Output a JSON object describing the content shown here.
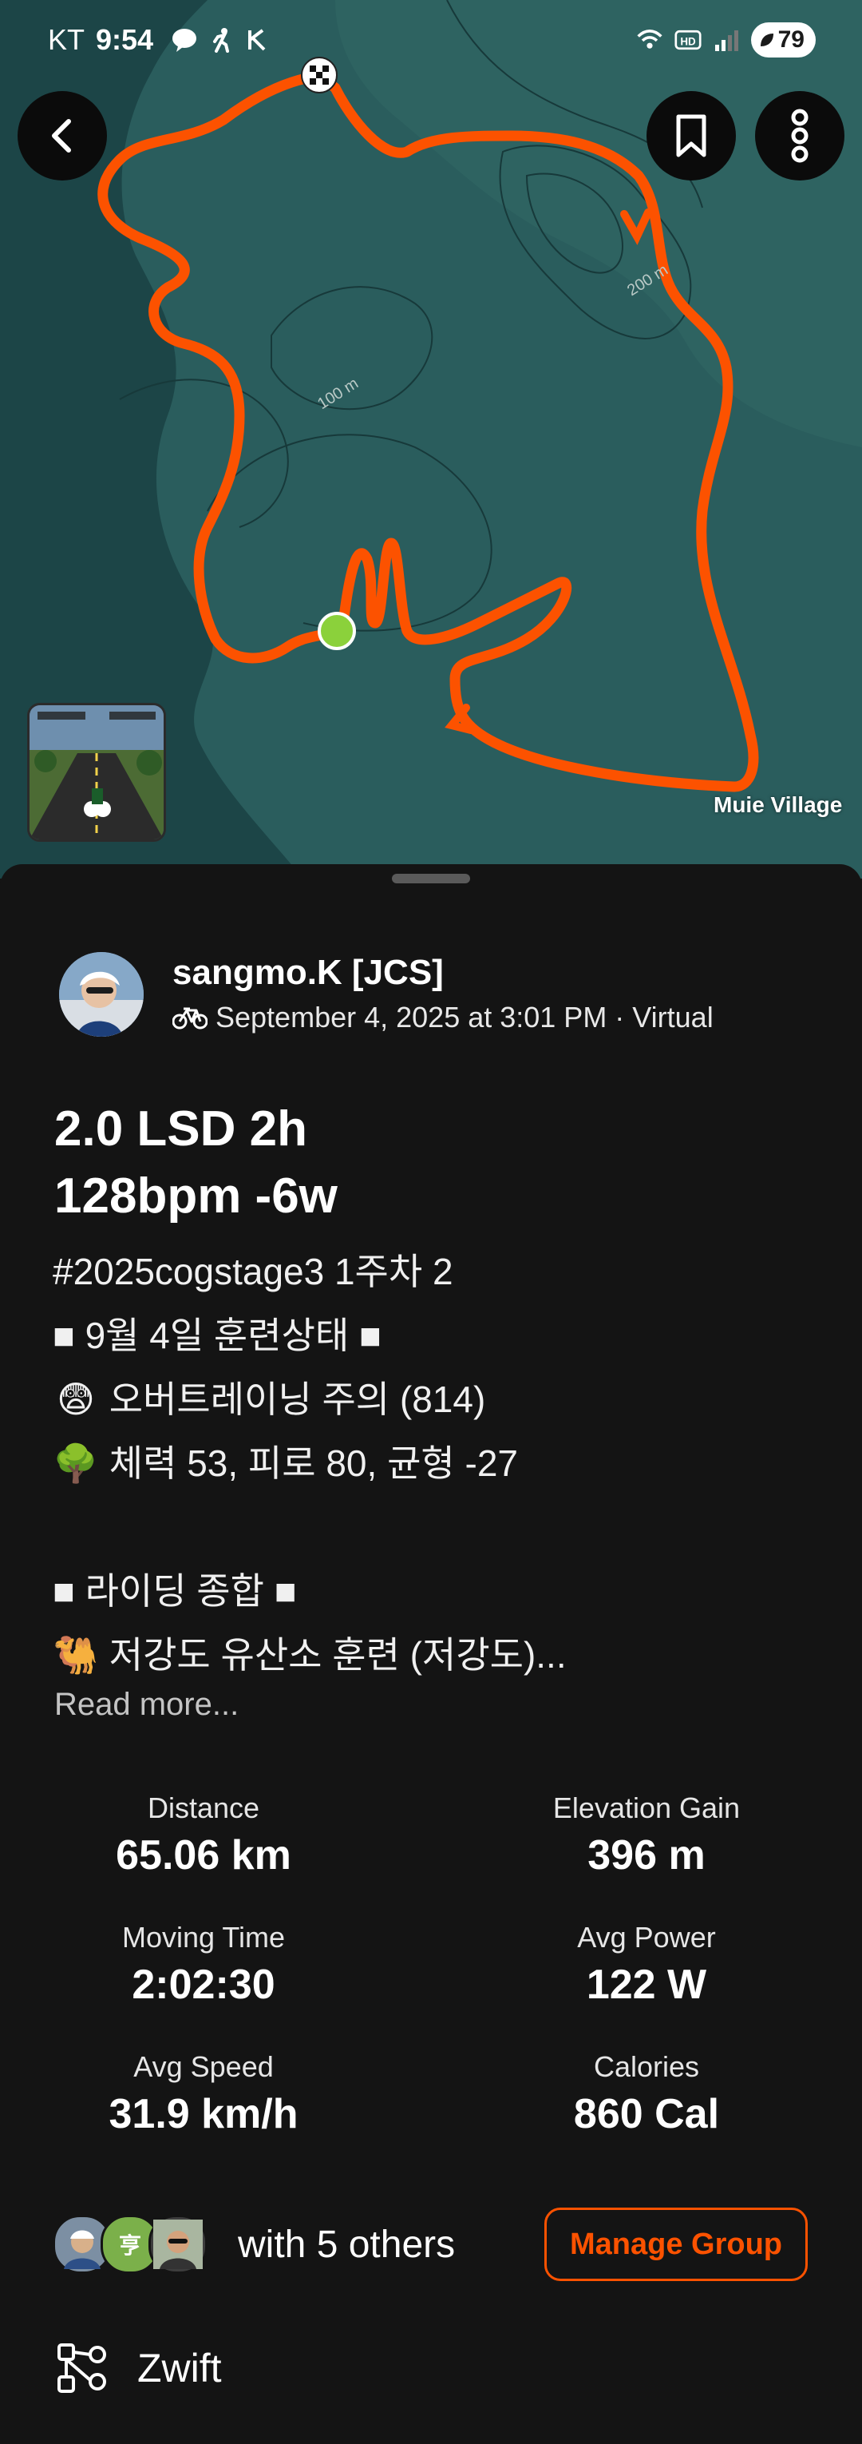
{
  "status_bar": {
    "carrier": "KT",
    "time": "9:54",
    "battery": "79",
    "icons": [
      "talk-icon",
      "runner-icon",
      "k-icon",
      "wifi-icon",
      "hd-icon",
      "signal-icon"
    ]
  },
  "map": {
    "contour_labels": [
      "100 m",
      "200 m"
    ],
    "place_label": "Muie Village",
    "route_color": "#fc5200",
    "start_color": "#8bd13b"
  },
  "activity": {
    "athlete_name": "sangmo.K [JCS]",
    "meta": "September 4, 2025 at 3:01 PM · Virtual",
    "title": "2.0 LSD 2h\n128bpm -6w",
    "description": [
      {
        "emoji": "",
        "text": "#2025cogstage3 1주차 2"
      },
      {
        "emoji": "",
        "text": "■ 9월 4일 훈련상태 ■"
      },
      {
        "emoji": "😨",
        "text": "오버트레이닝 주의 (814)"
      },
      {
        "emoji": "🌳",
        "text": "체력 53, 피로 80, 균형 -27"
      },
      {
        "emoji": "",
        "text": ""
      },
      {
        "emoji": "",
        "text": "■ 라이딩 종합 ■"
      },
      {
        "emoji": "🐫",
        "text": "저강도 유산소 훈련 (저강도)..."
      }
    ],
    "read_more": "Read more..."
  },
  "stats": [
    {
      "label": "Distance",
      "value": "65.06 km"
    },
    {
      "label": "Elevation Gain",
      "value": "396 m"
    },
    {
      "label": "Moving Time",
      "value": "2:02:30"
    },
    {
      "label": "Avg Power",
      "value": "122 W"
    },
    {
      "label": "Avg Speed",
      "value": "31.9 km/h"
    },
    {
      "label": "Calories",
      "value": "860 Cal"
    }
  ],
  "group": {
    "text": "with 5 others",
    "button": "Manage Group",
    "avatar_initial": "亨",
    "accent": "#fc5200"
  },
  "app": {
    "name": "Zwift",
    "icon": "device-connection-icon"
  }
}
